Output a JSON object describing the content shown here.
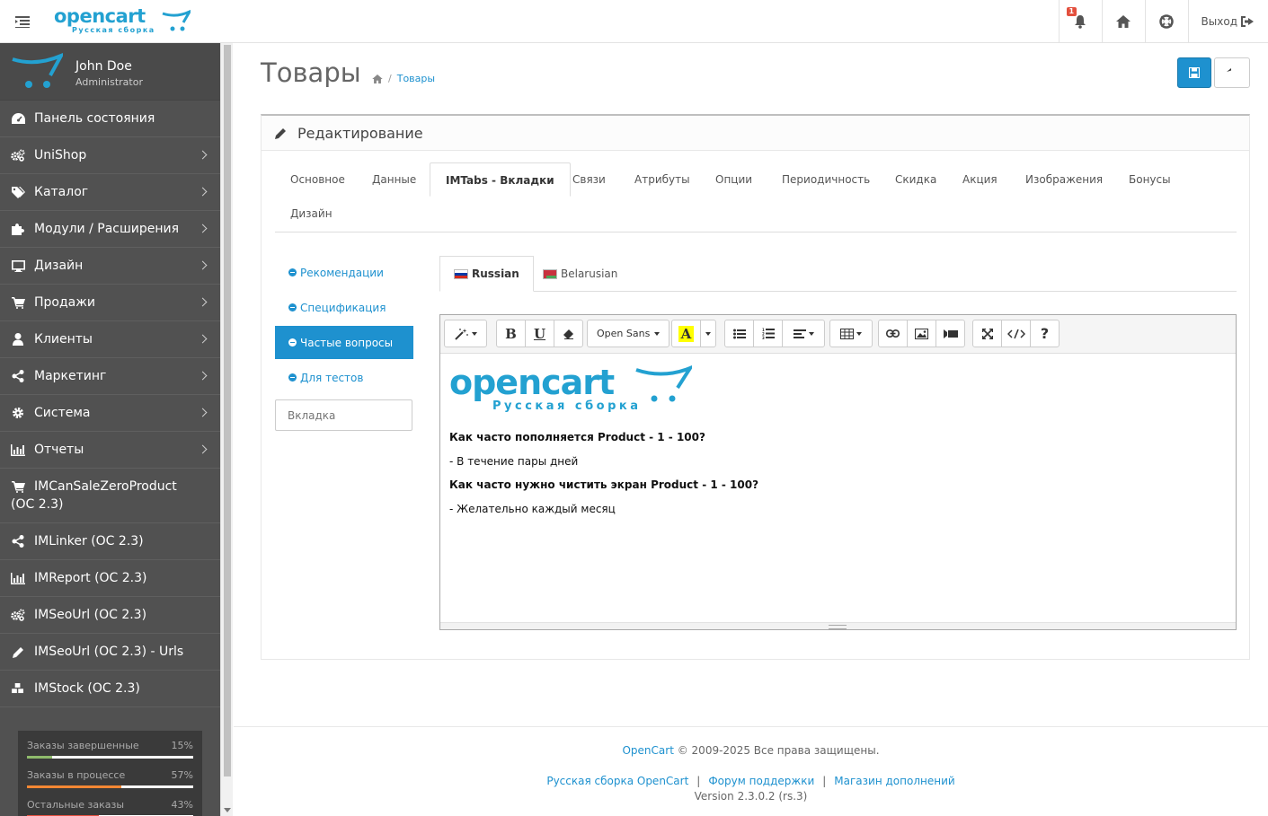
{
  "header": {
    "logo_word": "opencart",
    "logo_sub": "Русская сборка",
    "notifications_count": "1",
    "logout_label": "Выход"
  },
  "sidebar": {
    "profile": {
      "name": "John Doe",
      "role": "Administrator"
    },
    "items": [
      {
        "label": "Панель состояния",
        "icon": "dashboard-icon",
        "has_children": false
      },
      {
        "label": "UniShop",
        "icon": "cogs-icon",
        "has_children": true
      },
      {
        "label": "Каталог",
        "icon": "tags-icon",
        "has_children": true
      },
      {
        "label": "Модули / Расширения",
        "icon": "puzzle-icon",
        "has_children": true
      },
      {
        "label": "Дизайн",
        "icon": "desktop-icon",
        "has_children": true
      },
      {
        "label": "Продажи",
        "icon": "cart-icon",
        "has_children": true
      },
      {
        "label": "Клиенты",
        "icon": "user-icon",
        "has_children": true
      },
      {
        "label": "Маркетинг",
        "icon": "share-icon",
        "has_children": true
      },
      {
        "label": "Система",
        "icon": "cog-icon",
        "has_children": true
      },
      {
        "label": "Отчеты",
        "icon": "bar-chart-icon",
        "has_children": true
      },
      {
        "label": "IMCanSaleZeroProduct (OC 2.3)",
        "icon": "cart-icon",
        "has_children": false
      },
      {
        "label": "IMLinker (OC 2.3)",
        "icon": "share-icon",
        "has_children": false
      },
      {
        "label": "IMReport (OC 2.3)",
        "icon": "bar-chart-icon",
        "has_children": false
      },
      {
        "label": "IMSeoUrl (OC 2.3)",
        "icon": "cogs-icon",
        "has_children": false
      },
      {
        "label": "IMSeoUrl (OC 2.3) - Urls",
        "icon": "pencil-icon",
        "has_children": false
      },
      {
        "label": "IMStock (OC 2.3)",
        "icon": "cubes-icon",
        "has_children": false
      }
    ],
    "stats": [
      {
        "label": "Заказы завершенные",
        "value": "15%",
        "fraction": 0.15,
        "color": "#8fbb6c"
      },
      {
        "label": "Заказы в процессе",
        "value": "57%",
        "fraction": 0.57,
        "color": "#f38733"
      },
      {
        "label": "Остальные заказы",
        "value": "43%",
        "fraction": 0.43,
        "color": "#e3503e"
      }
    ]
  },
  "page": {
    "title": "Товары",
    "breadcrumb": [
      "Товары"
    ]
  },
  "panel": {
    "heading": "Редактирование",
    "tabs": [
      "Основное",
      "Данные",
      "IMTabs - Вкладки",
      "Связи",
      "Атрибуты",
      "Опции",
      "Периодичность",
      "Скидка",
      "Акция",
      "Изображения",
      "Бонусы",
      "Дизайн"
    ],
    "active_tab": "IMTabs - Вкладки",
    "vtabs": [
      "Рекомендации",
      "Спецификация",
      "Частые вопросы",
      "Для тестов"
    ],
    "active_vtab": "Частые вопросы",
    "vtab_input_placeholder": "Вкладка",
    "languages": [
      "Russian",
      "Belarusian"
    ],
    "active_language": "Russian",
    "editor": {
      "font_name": "Open Sans",
      "logo_word": "opencart",
      "logo_sub": "Русская сборка",
      "content": [
        {
          "type": "q",
          "text": "Как часто пополняется Product - 1 - 100?"
        },
        {
          "type": "a",
          "text": "- В течение пары дней"
        },
        {
          "type": "q",
          "text": "Как часто нужно чистить экран Product - 1 - 100?"
        },
        {
          "type": "a",
          "text": "- Желательно каждый месяц"
        }
      ]
    }
  },
  "footer": {
    "brand_link": "OpenCart",
    "copyright": "© 2009-2025 Все права защищены.",
    "links": [
      "Русская сборка OpenCart",
      "Форум поддержки",
      "Магазин дополнений"
    ],
    "separator": "|",
    "version": "Version 2.3.0.2 (rs.3)"
  },
  "colors": {
    "accent": "#1e91cf",
    "sidebar_bg": "#515151",
    "logo": "#23a1d1"
  }
}
